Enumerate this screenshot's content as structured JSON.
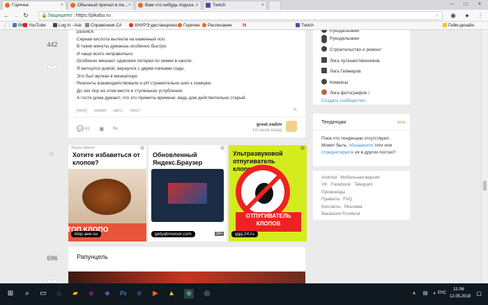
{
  "tabs": [
    {
      "label": "Горячее",
      "color": "#e86a22",
      "active": true
    },
    {
      "label": "Обычный причал в Ae...",
      "color": "#e86a22",
      "active": false
    },
    {
      "label": "Вам что нибудь подска...",
      "color": "#e86a22",
      "active": false
    },
    {
      "label": "Twitch",
      "color": "#6441a4",
      "active": false
    }
  ],
  "address": {
    "secure": "Защищено",
    "url": "https://pikabu.ru"
  },
  "bookmarks": [
    {
      "label": "ВК",
      "color": "#4a76a8"
    },
    {
      "label": "YouTube",
      "color": "#e62117"
    },
    {
      "label": "Log in - Ask",
      "color": "#444"
    },
    {
      "label": "Справочник C#",
      "color": "#666"
    },
    {
      "label": "ХНУРЭ дистанционн...",
      "color": "#d33"
    },
    {
      "label": "Горячее",
      "color": "#e86a22"
    },
    {
      "label": "Расписание",
      "color": "#e86a22"
    },
    {
      "label": "M",
      "color": "#d44638"
    },
    {
      "label": "Twitch",
      "color": "#6441a4"
    },
    {
      "label": "Гейм-дизайн",
      "color": "#f5c518"
    }
  ],
  "post1": {
    "votes": "442",
    "lines": [
      "разойся.",
      "Серная кислота вытекла на каменный пол.",
      "В такие минуты думаешь особенно быстро.",
      "И чаще всего неправильно.",
      "Особенно мешают одинокие пятерки по химии в школе.",
      "Я метнулся домой, вернулся с двумя пачками соды.",
      "Это был вулкан в миниатюре.",
      "Реагенты взаимодействовали и pH стремительно шел к семерке.",
      "До сих пор на этом месте в ступеньках углубления.",
      "А гости дома думают, что это приметы времени, ведь дом действительно старый."
    ],
    "tags": [
      "[моё]",
      "химия",
      "авто",
      "текст"
    ],
    "comments": "41",
    "author": "great.vadim",
    "time": "14 часов назад"
  },
  "ads": [
    {
      "source": "Яндекс.Директ",
      "title": "Хотите избавиться от клопов?",
      "domain": "klop.aee.su",
      "overlay": "ТОП КЛОПО"
    },
    {
      "title": "Обновленный Яндекс.Браузер",
      "domain": "getyabrowser.com",
      "age": "18+"
    },
    {
      "title": "Ультразвуковой отпугиватель клопов!",
      "banner1": "ОТПУГИВАТЕЛЬ",
      "banner2": "КЛОПОВ",
      "domain": "ggg-24.ru"
    }
  ],
  "post2": {
    "votes": "696",
    "title": "Рапунцель"
  },
  "sidebar": {
    "communities": [
      {
        "label": "Рукодельники",
        "extra": ""
      },
      {
        "label": "Строительство и ремонт",
        "extra": ""
      },
      {
        "label": "Лига путешественников",
        "extra": ""
      },
      {
        "label": "Лига Геймеров",
        "extra": ""
      },
      {
        "label": "Комиксы",
        "extra": ""
      },
      {
        "label": "Лига фотографов",
        "extra": "1"
      }
    ],
    "create": "Создать сообщество",
    "trends_title": "Тенденции",
    "trends_tab": "теги",
    "trends_text1": "Пока что тенденции отсутствуют.",
    "trends_text2a": "Может быть, ",
    "trends_link1": "объедините",
    "trends_text2b": " теги или",
    "trends_link2": "отредактируете",
    "trends_text3": " их в других постах?",
    "footer_links": [
      [
        "Android",
        "Мобильная версия"
      ],
      [
        "VK",
        "Facebook",
        "Telegram"
      ],
      [
        "Промокоды"
      ],
      [
        "Правила",
        "FAQ"
      ],
      [
        "Контакты",
        "Реклама"
      ],
      [
        "Вакансии Frontend"
      ]
    ]
  },
  "taskbar": {
    "time": "11:06",
    "date": "12.05.2018",
    "lang": "РУС"
  }
}
